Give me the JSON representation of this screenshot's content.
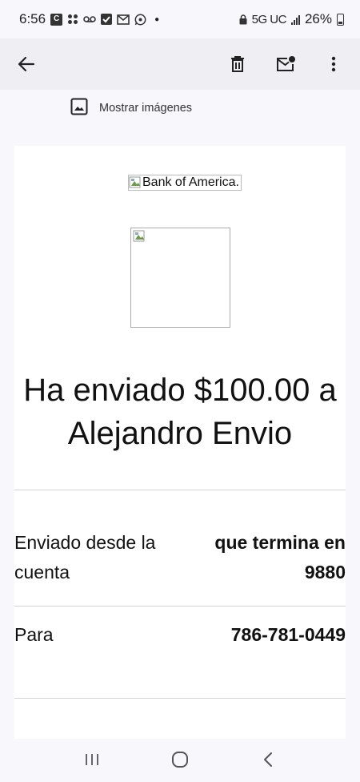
{
  "status_bar": {
    "time": "6:56",
    "network": "5G UC",
    "battery": "26%",
    "notification_icons": [
      "c-icon",
      "grid-icon",
      "voicemail-icon",
      "check-icon",
      "gmail-icon",
      "whatsapp-icon"
    ]
  },
  "app_bar": {
    "back_icon": "arrow-left-icon",
    "actions": [
      "delete-icon",
      "mark-unread-icon",
      "more-vert-icon"
    ]
  },
  "show_images": {
    "label": "Mostrar imágenes",
    "icon": "image-icon"
  },
  "email": {
    "logo_alt": "Bank of America.",
    "headline": "Ha enviado $100.00 a Alejandro Envio",
    "details": [
      {
        "label": "Enviado desde la cuenta",
        "value": "que termina en 9880"
      },
      {
        "label": "Para",
        "value": "786-781-0449"
      }
    ]
  },
  "nav_bar": {
    "buttons": [
      "recents-icon",
      "home-icon",
      "back-icon"
    ]
  }
}
